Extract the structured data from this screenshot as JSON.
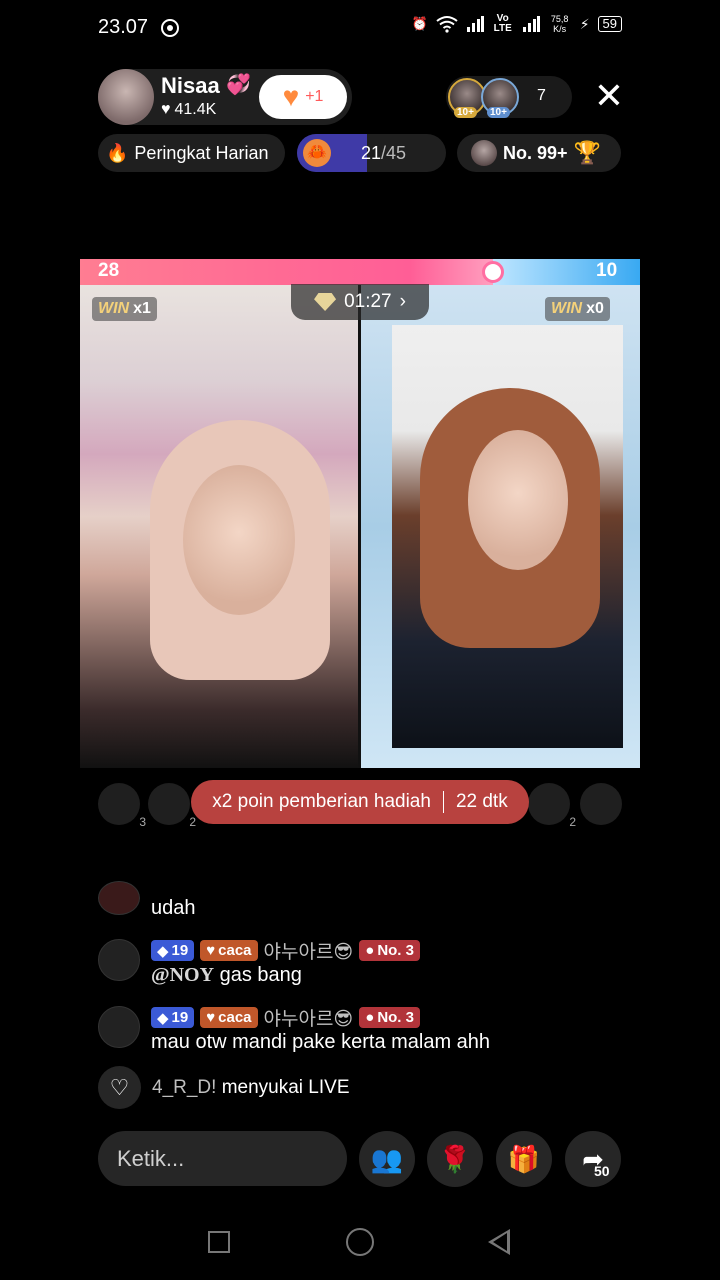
{
  "status_bar": {
    "time": "23.07",
    "network": "Vo LTE",
    "speed": "75,8 K/s",
    "battery": "59"
  },
  "host": {
    "name": "Nisaa",
    "name_emoji": "💞",
    "likes": "41.4K",
    "follow_plus": "+1"
  },
  "viewers": {
    "badge_1": "10+",
    "badge_2": "10+",
    "count": "7"
  },
  "chips": {
    "rank_label": "Peringkat Harian",
    "progress_current": "21",
    "progress_total": "/45",
    "progress_fraction": 0.467,
    "no_label": "No. 99+"
  },
  "battle": {
    "left_score": "28",
    "right_score": "10",
    "timer": "01:27",
    "left_win_label": "WIN",
    "left_win_count": "x1",
    "right_win_label": "WIN",
    "right_win_count": "x0",
    "colors": {
      "left": "#ff6b95",
      "right": "#39a9f2"
    }
  },
  "gifters": {
    "left_1": "3",
    "left_2": "2",
    "right_1": "2"
  },
  "multiplier": {
    "text": "x2 poin pemberian hadiah",
    "countdown": "22 dtk"
  },
  "chat": [
    {
      "text": "udah"
    },
    {
      "level": "19",
      "fan": "caca",
      "user": "야누아르😎",
      "rank": "No. 3",
      "mention": "@NOY",
      "text": " gas bang"
    },
    {
      "level": "19",
      "fan": "caca",
      "user": "야누아르😎",
      "rank": "No. 3",
      "text": "mau otw mandi pake kerta malam ahh"
    }
  ],
  "like_event": {
    "user": "4_R_D!",
    "text": "menyukai LIVE"
  },
  "input": {
    "placeholder": "Ketik..."
  },
  "actions": {
    "share_count": "50"
  }
}
